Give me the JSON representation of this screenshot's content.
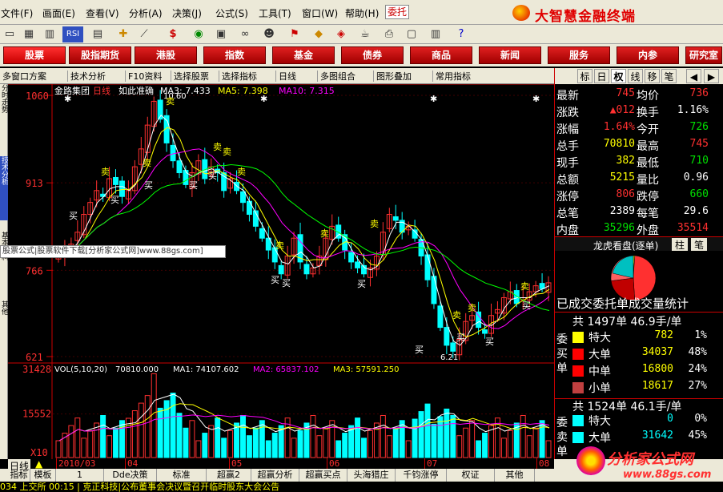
{
  "menu": {
    "items": [
      "文件(F)",
      "画面(E)",
      "查看(V)",
      "分析(A)",
      "决策(J)",
      "公式(S)",
      "工具(T)",
      "窗口(W)",
      "帮助(H)"
    ],
    "wt": "委托",
    "brand": "大智慧金融终端"
  },
  "tabs": [
    "股票",
    "股指期货",
    "港股",
    "指数",
    "基金",
    "债券",
    "商品",
    "新闻",
    "服务",
    "内参",
    "研究室"
  ],
  "toolbar2": [
    "多窗口方案",
    "技术分析",
    "F10资料",
    "选择股票",
    "选择指标",
    "日线",
    "多图组合",
    "图形叠加",
    "常用指标"
  ],
  "rtabs": [
    "标",
    "日",
    "权",
    "线",
    "移",
    "笔"
  ],
  "lefttabs": [
    "分时走势",
    "技术分析",
    "基本资料",
    "其他"
  ],
  "chart": {
    "stock_name": "金路集团",
    "period": "日线",
    "note": "如此准确",
    "ma3": "MA3: 7.433",
    "ma5": "MA5: 7.398",
    "ma10": "MA10: 7.315",
    "prices": [
      "1060",
      "913",
      "766",
      "621"
    ],
    "high_mark": "10.60",
    "low_mark": "6.21",
    "vol_label": "VOL(5,10,20)",
    "vol_val": "70810.000",
    "vma1": "MA1: 74107.602",
    "vma2": "MA2: 65837.102",
    "vma3": "MA3: 57591.250",
    "vols": [
      "31428",
      "15552",
      "X10"
    ],
    "dates": [
      "2010/03",
      "04",
      "05",
      "06",
      "07",
      "08"
    ],
    "sell": "卖",
    "buy": "买"
  },
  "chart_data": {
    "type": "candlestick",
    "title": "金路集团 日线",
    "ylim": [
      6.21,
      10.6
    ],
    "high": 10.6,
    "low": 6.21,
    "close": 7.45,
    "ma": {
      "MA3": 7.433,
      "MA5": 7.398,
      "MA10": 7.315
    },
    "volume": {
      "last": 70810,
      "MA1": 74107.602,
      "MA2": 65837.102,
      "MA3": 57591.25,
      "ymax": 31428
    }
  },
  "quote": {
    "rows": [
      {
        "l1": "最新",
        "v1": "745",
        "c1": "red",
        "l2": "均价",
        "v2": "736",
        "c2": "red"
      },
      {
        "l1": "涨跌",
        "v1": "▲012",
        "c1": "red",
        "l2": "换手",
        "v2": "1.16%",
        "c2": "white"
      },
      {
        "l1": "涨幅",
        "v1": "1.64%",
        "c1": "red",
        "l2": "今开",
        "v2": "726",
        "c2": "green"
      },
      {
        "l1": "总手",
        "v1": "70810",
        "c1": "yellow",
        "l2": "最高",
        "v2": "745",
        "c2": "red"
      },
      {
        "l1": "现手",
        "v1": "382",
        "c1": "yellow",
        "l2": "最低",
        "v2": "710",
        "c2": "green"
      },
      {
        "l1": "总额",
        "v1": "5215",
        "c1": "yellow",
        "l2": "量比",
        "v2": "0.96",
        "c2": "white"
      },
      {
        "l1": "涨停",
        "v1": "806",
        "c1": "red",
        "l2": "跌停",
        "v2": "660",
        "c2": "green"
      },
      {
        "l1": "总笔",
        "v1": "2389",
        "c1": "white",
        "l2": "每笔",
        "v2": "29.6",
        "c2": "white"
      },
      {
        "l1": "内盘",
        "v1": "35296",
        "c1": "green",
        "l2": "外盘",
        "v2": "35514",
        "c2": "red"
      }
    ],
    "dragon": "龙虎看盘(逐单)",
    "zhu": "柱",
    "bi": "笔",
    "stat_title": "已成交委托单成交量统计",
    "buy_total": "共 1497单 46.9手/单",
    "buy_side": "委买单",
    "buy": [
      {
        "k": "特大",
        "v": "782",
        "p": "1%",
        "c": "yellow"
      },
      {
        "k": "大单",
        "v": "34037",
        "p": "48%",
        "c": "red"
      },
      {
        "k": "中单",
        "v": "16800",
        "p": "24%",
        "c": "#ff0000"
      },
      {
        "k": "小单",
        "v": "18617",
        "p": "27%",
        "c": "#c04040"
      }
    ],
    "sell_total": "共 1524单 46.1手/单",
    "sell_side": "委卖单",
    "sell": [
      {
        "k": "特大",
        "v": "0",
        "p": "0%",
        "c": "cyan"
      },
      {
        "k": "大单",
        "v": "31642",
        "p": "45%",
        "c": "cyan"
      }
    ]
  },
  "bottom": {
    "tabs": [
      "指标",
      "模板",
      "1",
      "Dde决策",
      "标准",
      "超赢2",
      "超赢分析",
      "超赢买点",
      "头海猎庄(1)",
      "千钧涨停",
      "权证",
      "其他"
    ],
    "period": "日线",
    "ticker": "034 上交所    00:15 | 克正科技|公布董事会决议暨召开临时股东大会公告"
  },
  "watermark": "股票公式|股票软件下载[分析家公式网]www.88gs.com]",
  "wm2": {
    "title": "分析家公式网",
    "url": "www.88gs.com"
  },
  "colors": {
    "up": "#ff3030",
    "down": "#00ffff",
    "ma3": "#ffffff",
    "ma5": "#ffff00",
    "ma10": "#ff00ff",
    "ma20": "#00ff00"
  }
}
